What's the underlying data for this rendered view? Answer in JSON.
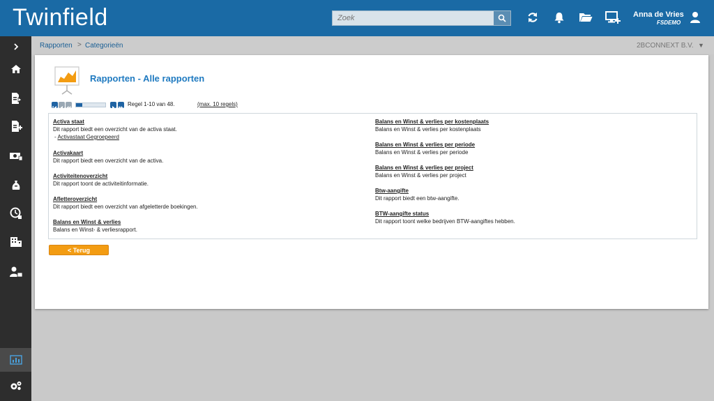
{
  "app": {
    "title": "Twinfield"
  },
  "search": {
    "placeholder": "Zoek"
  },
  "user": {
    "name": "Anna de Vries",
    "code": "FSDEMO"
  },
  "breadcrumb": {
    "items": [
      "Rapporten",
      "Categorieën"
    ],
    "separator": ">"
  },
  "company": {
    "name": "2BCONNEXT B.V."
  },
  "page": {
    "title": "Rapporten - Alle rapporten"
  },
  "pager": {
    "text": "Regel 1-10 van 48.",
    "max_label": "(max. 10 regels)",
    "progress": 0.21
  },
  "reports_left": [
    {
      "title": "Activa staat",
      "desc": "Dit rapport biedt een overzicht van de activa staat.",
      "sub": "Activastaat Gegroepeerd"
    },
    {
      "title": "Activakaart",
      "desc": "Dit rapport biedt een overzicht van de activa."
    },
    {
      "title": "Activiteitenoverzicht",
      "desc": "Dit rapport toont de activiteitinformatie."
    },
    {
      "title": "Afletteroverzicht",
      "desc": "Dit rapport biedt een overzicht van afgeletterde boekingen."
    },
    {
      "title": "Balans en Winst & verlies",
      "desc": "Balans en Winst- & verliesrapport."
    }
  ],
  "reports_right": [
    {
      "title": "Balans en Winst & verlies per kostenplaats",
      "desc": "Balans en Winst & verlies per kostenplaats"
    },
    {
      "title": "Balans en Winst & verlies per periode",
      "desc": "Balans en Winst & verlies per periode"
    },
    {
      "title": "Balans en Winst & verlies per project",
      "desc": "Balans en Winst & verlies per project"
    },
    {
      "title": "Btw-aangifte",
      "desc": "Dit rapport biedt een btw-aangifte."
    },
    {
      "title": "BTW-aangifte status",
      "desc": "Dit rapport toont welke bedrijven BTW-aangiftes hebben."
    }
  ],
  "back_button": {
    "label": "< Terug"
  },
  "icons": {
    "sidebar": [
      "expand-icon",
      "home-icon",
      "invoice-out-icon",
      "invoice-in-icon",
      "cash-icon",
      "money-bag-icon",
      "clock-icon",
      "building-icon",
      "user-lock-icon",
      "reports-icon",
      "settings-icon"
    ],
    "topbar": [
      "refresh-icon",
      "bell-icon",
      "folder-icon",
      "monitor-add-icon",
      "user-icon"
    ]
  },
  "colors": {
    "brand": "#1a6aa5",
    "accent": "#f39c12",
    "link": "#1f7ac0",
    "sidebar": "#2d2d2d"
  }
}
